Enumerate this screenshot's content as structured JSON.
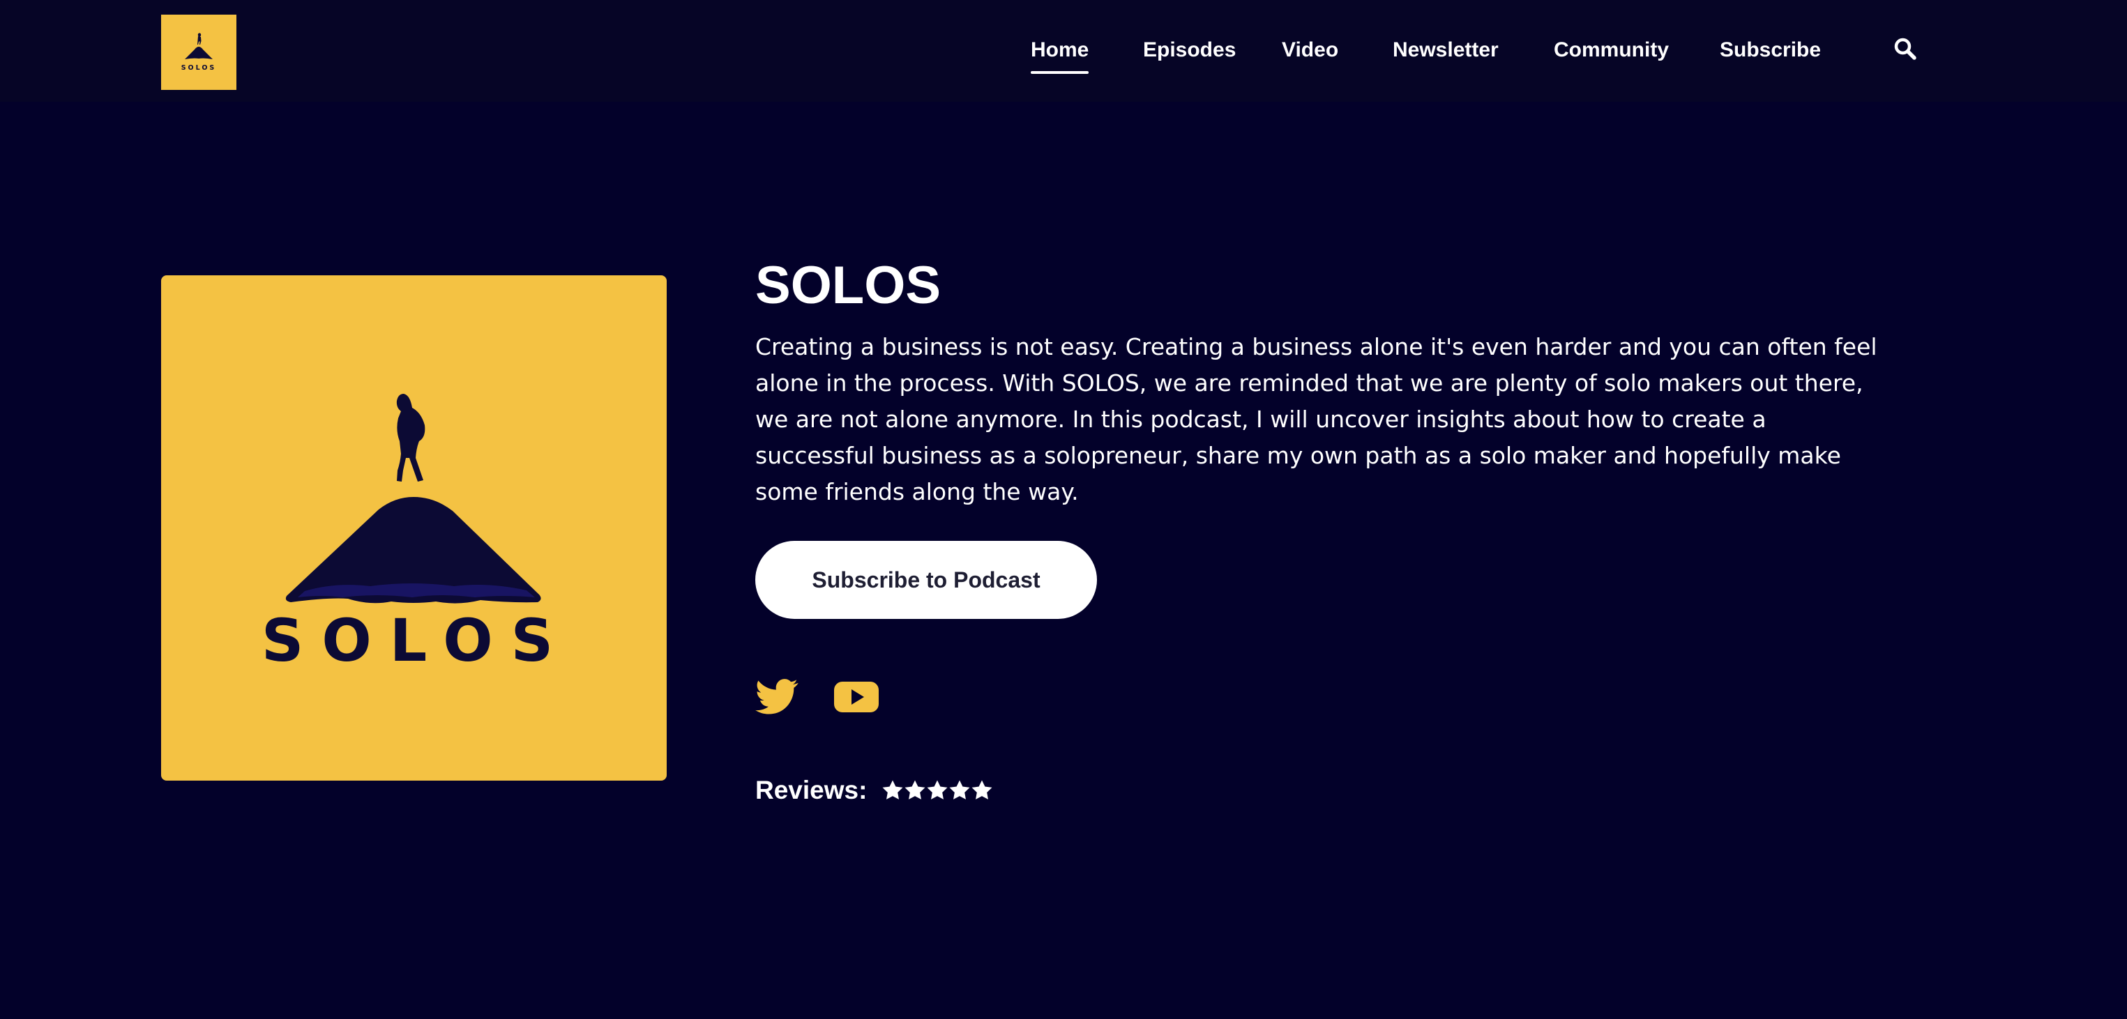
{
  "brand": {
    "logo_text": "SOLOS",
    "accent_color": "#f4c243",
    "background_color": "#03012a",
    "header_color": "#060526"
  },
  "nav": {
    "items": [
      {
        "label": "Home",
        "active": true
      },
      {
        "label": "Episodes",
        "active": false
      },
      {
        "label": "Video",
        "active": false
      },
      {
        "label": "Newsletter",
        "active": false
      },
      {
        "label": "Community",
        "active": false
      },
      {
        "label": "Subscribe",
        "active": false
      }
    ],
    "search_icon": "search-icon"
  },
  "podcast": {
    "cover_text": "SOLOS",
    "title": "SOLOS",
    "description": "Creating a business is not easy. Creating a business alone it's even harder and you can often feel alone in the process. With SOLOS, we are reminded that we are plenty of solo makers out there, we are not alone anymore. In this podcast, I will uncover insights about how to create a successful business as a solopreneur, share my own path as a solo maker and hopefully make some friends along the way.",
    "subscribe_label": "Subscribe to Podcast"
  },
  "social": {
    "icons": [
      "twitter-icon",
      "youtube-icon"
    ]
  },
  "reviews": {
    "label": "Reviews:",
    "rating": 5,
    "max_rating": 5
  }
}
